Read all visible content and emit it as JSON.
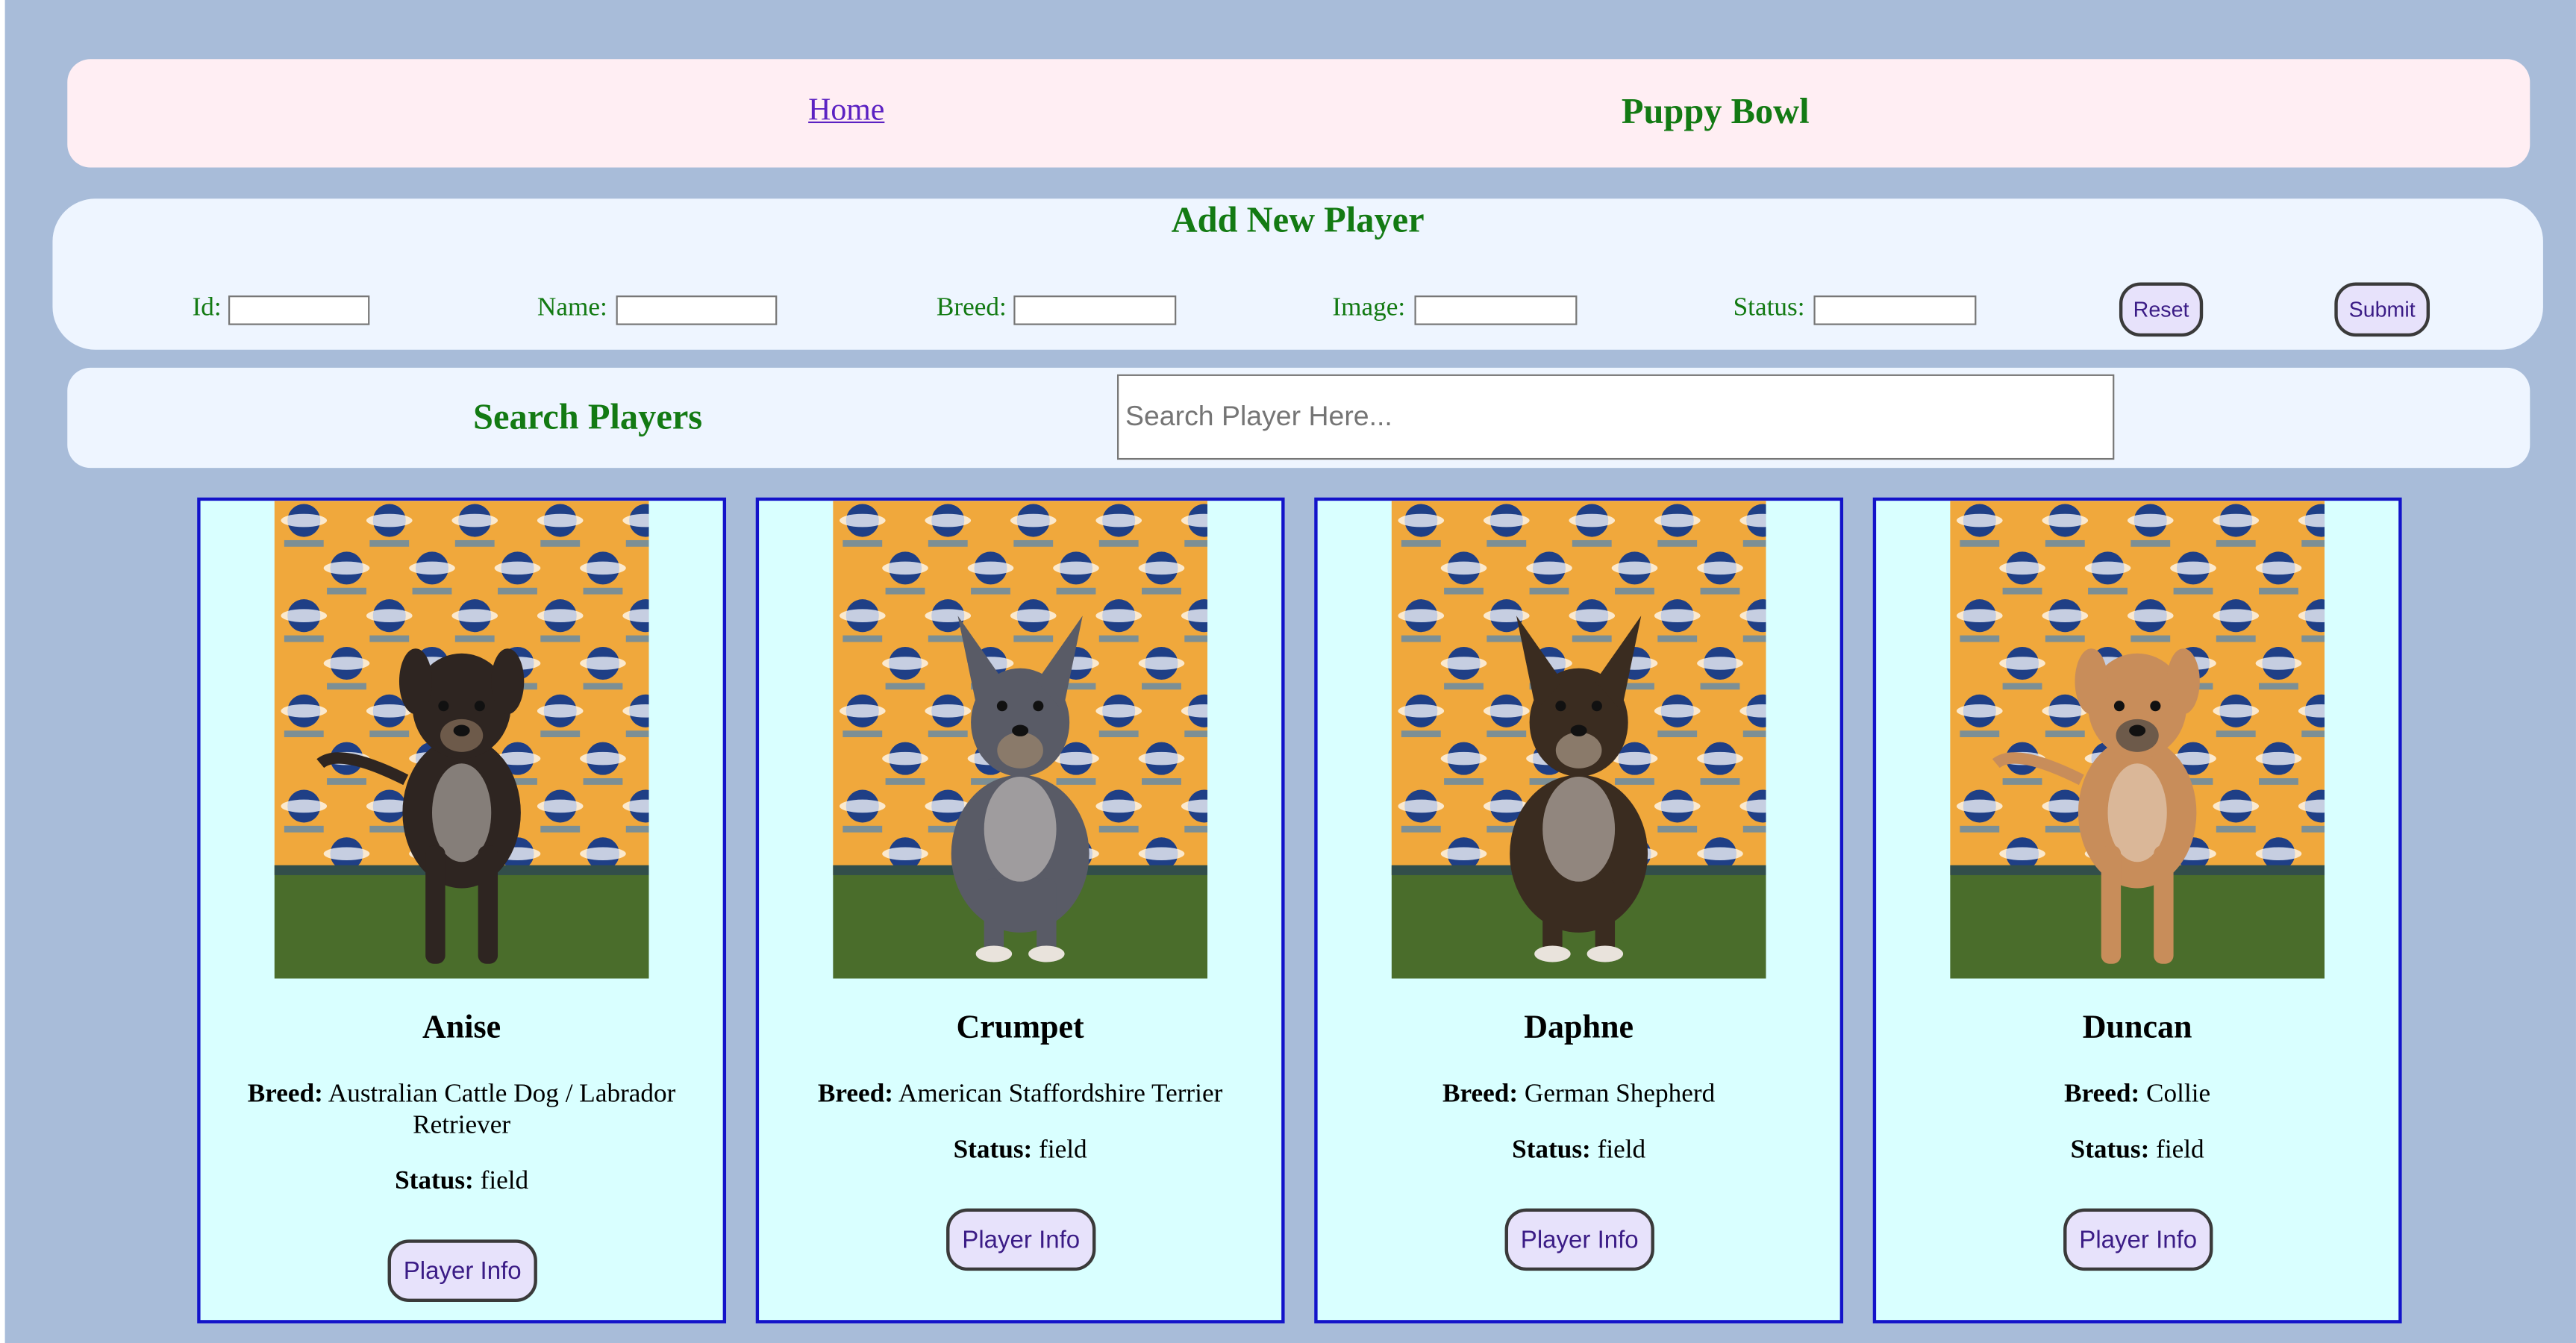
{
  "nav": {
    "home_link": "Home",
    "title": "Puppy Bowl"
  },
  "add_form": {
    "title": "Add New Player",
    "fields": [
      {
        "label": "Id:",
        "value": ""
      },
      {
        "label": "Name:",
        "value": ""
      },
      {
        "label": "Breed:",
        "value": ""
      },
      {
        "label": "Image:",
        "value": ""
      },
      {
        "label": "Status:",
        "value": ""
      }
    ],
    "reset_label": "Reset",
    "submit_label": "Submit"
  },
  "search": {
    "title": "Search Players",
    "placeholder": "Search Player Here..."
  },
  "labels": {
    "breed": "Breed:",
    "status": "Status:",
    "info_button": "Player Info"
  },
  "players": [
    {
      "name": "Anise",
      "breed": "Australian Cattle Dog / Labrador Retriever",
      "status": "field",
      "pose": "standing",
      "coat": "#2e2521"
    },
    {
      "name": "Crumpet",
      "breed": "American Staffordshire Terrier",
      "status": "field",
      "pose": "sitting",
      "coat": "#595b66"
    },
    {
      "name": "Daphne",
      "breed": "German Shepherd",
      "status": "field",
      "pose": "sitting",
      "coat": "#3a2c20"
    },
    {
      "name": "Duncan",
      "breed": "Collie",
      "status": "field",
      "pose": "standing",
      "coat": "#c88d5a"
    }
  ],
  "colors": {
    "page_bg": "#a8bcd9",
    "nav_bg": "#ffeef3",
    "panel_bg": "#eef5ff",
    "card_bg": "#d9ffff",
    "card_border": "#1313c9",
    "heading_green": "#137a13",
    "link_purple": "#5b21c2",
    "button_bg": "#e7e2fb",
    "photo_backdrop": "#f0a83c",
    "photo_turf": "#4a6d2b"
  }
}
